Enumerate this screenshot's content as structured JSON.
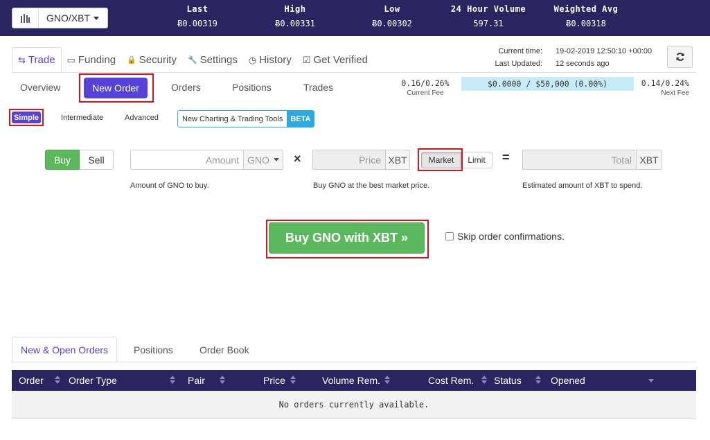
{
  "ticker": {
    "pair": "GNO/XBT",
    "stats": [
      {
        "label": "Last",
        "value": "Ƀ0.00319"
      },
      {
        "label": "High",
        "value": "Ƀ0.00331"
      },
      {
        "label": "Low",
        "value": "Ƀ0.00302"
      },
      {
        "label": "24 Hour Volume",
        "value": "597.31"
      },
      {
        "label": "Weighted Avg",
        "value": "Ƀ0.00318"
      }
    ]
  },
  "nav": {
    "tabs": [
      {
        "label": "Trade",
        "icon": "exchange-icon",
        "glyph": "⇆"
      },
      {
        "label": "Funding",
        "icon": "money-icon",
        "glyph": "▭"
      },
      {
        "label": "Security",
        "icon": "lock-icon",
        "glyph": "🔒"
      },
      {
        "label": "Settings",
        "icon": "wrench-icon",
        "glyph": "🔧"
      },
      {
        "label": "History",
        "icon": "clock-icon",
        "glyph": "◷"
      },
      {
        "label": "Get Verified",
        "icon": "check-square-icon",
        "glyph": "☑"
      }
    ],
    "active": "Trade"
  },
  "time": {
    "current_label": "Current time:",
    "current_value": "19-02-2019 12:50:10 +00:00",
    "updated_label": "Last Updated:",
    "updated_value": "12 seconds ago"
  },
  "subnav": {
    "items": [
      "Overview",
      "New Order",
      "Orders",
      "Positions",
      "Trades"
    ],
    "active": "New Order"
  },
  "fees": {
    "current_value": "0.16/0.26%",
    "current_label": "Current Fee",
    "volume_bar": "$0.0000 / $50,000 (0.00%)",
    "volume_progress": 0.0,
    "next_value": "0.14/0.24%",
    "next_label": "Next Fee"
  },
  "modes": {
    "items": [
      "Simple",
      "Intermediate",
      "Advanced"
    ],
    "active": "Simple",
    "charting_label": "New Charting & Trading Tools",
    "beta_label": "BETA"
  },
  "form": {
    "buy_label": "Buy",
    "sell_label": "Sell",
    "side": "Buy",
    "amount_placeholder": "Amount",
    "amount_value": "",
    "amount_currency": "GNO",
    "times_symbol": "×",
    "price_placeholder": "Price",
    "price_currency": "XBT",
    "market_label": "Market",
    "limit_label": "Limit",
    "order_type": "Market",
    "equals_symbol": "=",
    "total_placeholder": "Total",
    "total_currency": "XBT",
    "amount_help": "Amount of GNO to buy.",
    "price_help": "Buy GNO at the best market price.",
    "total_help": "Estimated amount of XBT to spend.",
    "submit_label": "Buy GNO with XBT »",
    "skip_label": "Skip order confirmations.",
    "skip_checked": false
  },
  "bottom": {
    "tabs": [
      "New & Open Orders",
      "Positions",
      "Order Book"
    ],
    "active": "New & Open Orders",
    "columns": [
      "Order",
      "Order Type",
      "Pair",
      "Price",
      "Volume Rem.",
      "Cost Rem.",
      "Status",
      "Opened"
    ],
    "empty_message": "No orders currently available."
  },
  "colors": {
    "header_bg": "#2a2560",
    "accent": "#5741d9",
    "buy_green": "#5cb85c",
    "info_blue": "#2da9e1",
    "highlight_red": "#d9141a"
  }
}
